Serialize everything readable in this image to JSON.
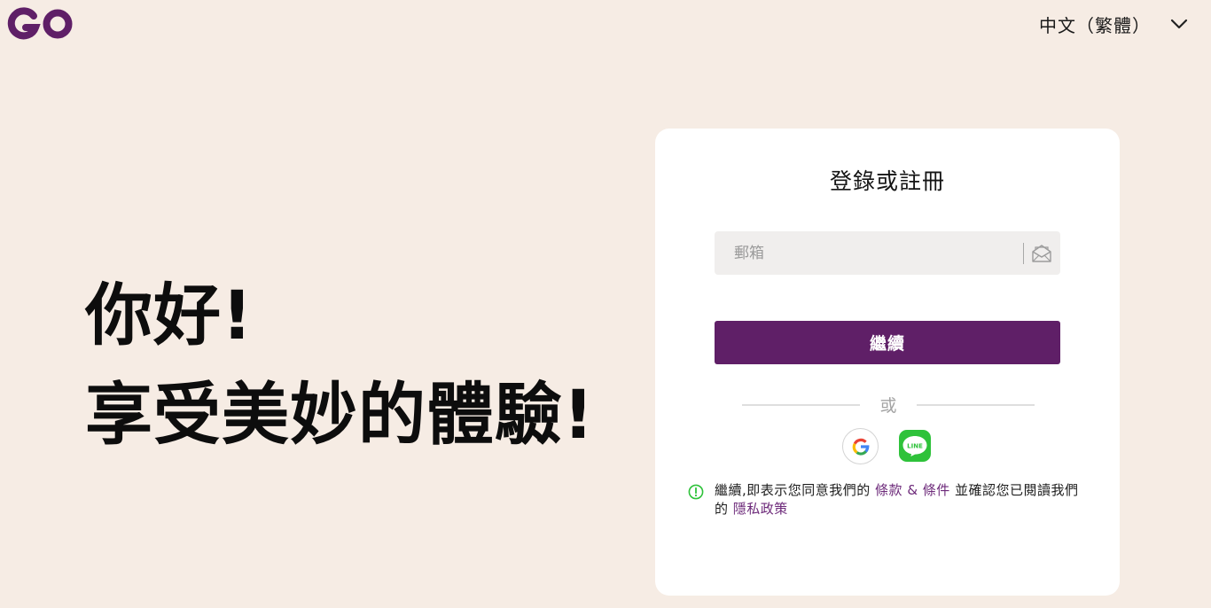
{
  "header": {
    "logo_text": "GO",
    "language_label": "中文（繁體）",
    "language_icon": "chevron-down-icon"
  },
  "hero": {
    "line1": "你好!",
    "line2": "享受美妙的體驗!"
  },
  "login": {
    "title": "登錄或註冊",
    "email_placeholder": "郵箱",
    "email_icon": "envelope-icon",
    "continue_label": "繼續",
    "or_label": "或",
    "social": [
      {
        "name": "google",
        "icon": "google-icon"
      },
      {
        "name": "line",
        "icon": "line-icon"
      }
    ],
    "terms": {
      "icon": "info-circle-icon",
      "prefix": "繼續,即表示您同意我們的 ",
      "terms_link": "條款 & 條件",
      "middle": " 並確認您已閱讀我們的 ",
      "privacy_link": "隱私政策"
    }
  },
  "colors": {
    "background": "#f6ece4",
    "brand": "#5f1f67",
    "line_green": "#2ec23a",
    "info_green": "#2ec23a"
  }
}
